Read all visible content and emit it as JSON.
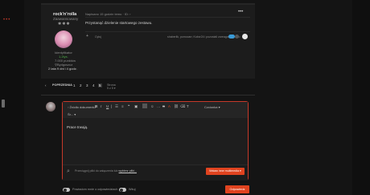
{
  "page": {
    "background": "#141414",
    "accent": "#e0431f",
    "border_accent": "#c5392a"
  },
  "post": {
    "author": {
      "username": "rock'n'rolla",
      "rank": "Zaawansowany",
      "stars": "✱✱✱",
      "id_label": "Identyfikator",
      "reputation": "1,2tys.",
      "points": "7.000 punktów",
      "location": "Bydgoszcz",
      "hours": "2 lata 9 dni i 4 godz."
    },
    "timestamp": "Napisano 15 godzin temu",
    "timestamp_suffix": "· ID: ›",
    "options_icon": "ellipsis-icon",
    "text": "Przystanąć dzielenie startowego zestawu.",
    "like_icon": "plus-icon",
    "like_label": "Cytuj",
    "reactions_text": "shaberlik, pomocarr, Kubcr24 i pozostali zareagowali na to",
    "badge_color": "#3a9ad6"
  },
  "pagination": {
    "prev_label": "‹",
    "prefix_label": "POPRZEDNIA",
    "pages": [
      "1",
      "2",
      "3",
      "4",
      "5"
    ],
    "active_index": 4,
    "next_label": "Strona 5 z 5 ▾"
  },
  "editor": {
    "toolbar": {
      "source_label": "Źródło dokumentu",
      "bold": "B",
      "italic": "I",
      "underline": "U",
      "strike": "S",
      "list1": "☰",
      "list2": "≡",
      "link": "🔗",
      "quote": "❝",
      "image": "▣",
      "emoji": "☺",
      "more": "…",
      "color": "A",
      "font_size": "T",
      "font_label": "Czcionka ▾",
      "row2_label": "Śr... ▾",
      "clear_icon": "eraser-icon"
    },
    "content": "Prace trwają.",
    "attach_text": "Przeciągnij pliki do załączenia lub",
    "attach_link": "wybierz pliki...",
    "media_button": "Wstaw inne multimedia ▾"
  },
  "footer": {
    "follow_label": "Powiadom mnie o odpowiedziach",
    "anon_label": "Wkuj",
    "submit_label": "Odpowiedz"
  }
}
